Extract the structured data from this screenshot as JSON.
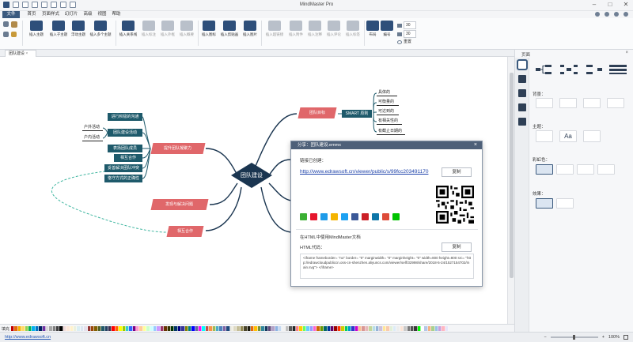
{
  "app": {
    "title": "MindMaster Pro"
  },
  "menu": {
    "file": "文件",
    "tabs": [
      "首页",
      "页面样式",
      "幻灯片",
      "高级",
      "视图",
      "帮助"
    ]
  },
  "ribbon": {
    "buttons": [
      {
        "label": "插入主题",
        "icon": "insert-topic-icon",
        "dim": false
      },
      {
        "label": "插入子主题",
        "icon": "insert-subtopic-icon",
        "dim": false
      },
      {
        "label": "浮动主题",
        "icon": "floating-topic-icon",
        "dim": false
      },
      {
        "label": "插入多个主题",
        "icon": "multiple-topics-icon",
        "dim": false
      },
      {
        "label": "插入关系线",
        "icon": "relationship-icon",
        "dim": false
      },
      {
        "label": "插入标注",
        "icon": "callout-icon",
        "dim": true
      },
      {
        "label": "插入外框",
        "icon": "boundary-icon",
        "dim": true
      },
      {
        "label": "插入概要",
        "icon": "summary-icon",
        "dim": true
      },
      {
        "label": "插入图标",
        "icon": "insert-icon-icon",
        "dim": false
      },
      {
        "label": "插入剪贴画",
        "icon": "clipart-icon",
        "dim": false
      },
      {
        "label": "插入图片",
        "icon": "picture-icon",
        "dim": false
      },
      {
        "label": "插入超链接",
        "icon": "hyperlink-icon",
        "dim": true
      },
      {
        "label": "插入附件",
        "icon": "attachment-icon",
        "dim": true
      },
      {
        "label": "插入注释",
        "icon": "note-icon",
        "dim": true
      },
      {
        "label": "插入评论",
        "icon": "comment-icon",
        "dim": true
      },
      {
        "label": "插入标签",
        "icon": "tag-icon",
        "dim": true
      },
      {
        "label": "布局",
        "icon": "layout-icon",
        "dim": false
      },
      {
        "label": "编号",
        "icon": "numbering-icon",
        "dim": false
      }
    ],
    "spin1": "30",
    "spin2": "30",
    "reset": "重置"
  },
  "document": {
    "tab": "团队建设"
  },
  "mindmap": {
    "center": "团队建设",
    "main_topics": [
      {
        "label": "团队目标"
      },
      {
        "label": "提升团队凝聚力"
      },
      {
        "label": "发现与解决问题"
      },
      {
        "label": "相互合作"
      }
    ],
    "smart_label": "SMART 原则",
    "smart_items": [
      "具体的",
      "可衡量的",
      "可达到的",
      "有相关性的",
      "有截止日期的"
    ],
    "cohesion_items": [
      "进行积极的沟通",
      "团队建设活动",
      "表扬团队成员",
      "相互合作",
      "妥善解决团队冲突",
      "恪守方式的正确性"
    ],
    "activity_items": [
      "户外活动",
      "户内活动"
    ]
  },
  "dialog": {
    "title": "分享：团队建设.emmx",
    "link_label": "链接已创建：",
    "url": "http://www.edrawsoft.cn/viewer/public/s/99fcc203491170",
    "copy1": "复制",
    "social": [
      "wechat-icon",
      "weibo-icon",
      "qq-icon",
      "qzone-icon",
      "twitter-icon",
      "facebook-icon",
      "pinterest-icon",
      "linkedin-icon",
      "googleplus-icon",
      "line-icon"
    ],
    "html_intro": "在HTML中使用MindMaster文档",
    "html_label": "HTML代码：",
    "copy2": "复制",
    "code": "<iframe frameborder= \"no\" border= \"0\" marginwidth= \"0\" marginheight= \"0\" width=800 height=800 src= \"http://edrawcloudpubliccn.oss-cn-shenzhen.aliyuncs.com/viewer/self/32998/share/2018-5-24/1527154702/main.svg\"> </iframe>"
  },
  "panel": {
    "title": "页面",
    "bg_label": "背景：",
    "theme_label": "主题：",
    "theme_text": "Aa",
    "colors_label": "彩虹色：",
    "effect_label": "效果："
  },
  "palette": {
    "label": "填充",
    "colors": [
      "#c00000",
      "#e46c0a",
      "#f5b400",
      "#ffd966",
      "#92d050",
      "#00b050",
      "#00b0f0",
      "#0070c0",
      "#002060",
      "#7030a0",
      "#d9d9d9",
      "#a6a6a6",
      "#7f7f7f",
      "#404040",
      "#000000",
      "#f2dcdb",
      "#fde9d9",
      "#fff2cc",
      "#ebf1de",
      "#dbeef3",
      "#dce6f1",
      "#e5e0ec",
      "#953735",
      "#984807",
      "#7f6000",
      "#4f6228",
      "#215868",
      "#244062",
      "#3f3151",
      "#ff0000",
      "#ff6600",
      "#ffff00",
      "#99cc00",
      "#33cccc",
      "#3366ff",
      "#800080",
      "#ff99cc",
      "#ffcc99",
      "#ffff99",
      "#ccffcc",
      "#ccffff",
      "#99ccff",
      "#cc99ff",
      "#993366",
      "#663300",
      "#333300",
      "#003300",
      "#003366",
      "#000080",
      "#333399",
      "#808000",
      "#008080",
      "#0000ff",
      "#666699",
      "#ff00ff",
      "#00ffff",
      "#c0504d",
      "#f79646",
      "#9bbb59",
      "#4bacc6",
      "#4f81bd",
      "#8064a2",
      "#1f497d",
      "#eeece1",
      "#ddd9c3",
      "#c4bd97",
      "#938953",
      "#494429",
      "#1d1b10",
      "#e36c09",
      "#ffc000",
      "#76923c",
      "#31859b",
      "#17365d",
      "#5f497a",
      "#b2a2c7",
      "#8db3e2",
      "#c6d9f0",
      "#f2f2f2",
      "#bfbfbf",
      "#595959",
      "#262626",
      "#ff8080",
      "#ffcc00",
      "#66ff66",
      "#66ccff",
      "#9999ff",
      "#ff66cc",
      "#cc6600",
      "#669900",
      "#006666",
      "#003399",
      "#660066",
      "#990000",
      "#ff3300",
      "#cccc00",
      "#00cc66",
      "#0099cc",
      "#3333cc",
      "#cc00cc",
      "#fabf8f",
      "#d99694",
      "#e6b9b8",
      "#c3d69b",
      "#b7dde8",
      "#95b3d7",
      "#ccc1da",
      "#ffe699",
      "#f8cbad",
      "#e2efda",
      "#ddebf7",
      "#ededed",
      "#fce4d6",
      "#c9c9c9",
      "#7b7b7b",
      "#525252",
      "#3a3838",
      "#00ff00",
      "#ffffff",
      "#b4c6e7",
      "#f4b183",
      "#a9d08e",
      "#9bc2e6",
      "#c9a0dc",
      "#ffb6c1",
      "#e6e6fa"
    ]
  },
  "status": {
    "link": "http://www.edrawsoft.cn",
    "zoom": "100%"
  },
  "colors": {
    "main_topic": "#e0676a",
    "sub_topic": "#1e5a6b",
    "center": "#1a3550",
    "dialog_header": "#4e6079",
    "file_tab": "#3b5a7e"
  }
}
